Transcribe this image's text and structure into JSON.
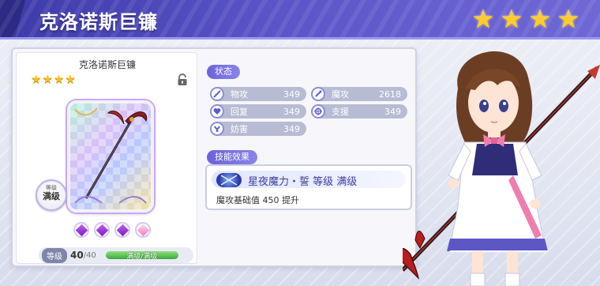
{
  "header": {
    "title": "克洛诺斯巨镰",
    "stars": [
      "★",
      "★",
      "★",
      "★"
    ]
  },
  "weapon": {
    "name": "克洛诺斯巨镰",
    "stars": [
      "★",
      "★",
      "★",
      "★"
    ],
    "badge_small": "等级",
    "badge_main": "满级",
    "gems": [
      "purple",
      "purple",
      "purple",
      "pink"
    ],
    "level_label": "等级",
    "level_current": "40",
    "level_max": "/40",
    "level_progress": 1.0,
    "level_bar_text": "满级/满级"
  },
  "status": {
    "tab": "状态",
    "stats": [
      {
        "icon": "sword-icon",
        "label": "物攻",
        "value": "349"
      },
      {
        "icon": "magic-wand-icon",
        "label": "魔攻",
        "value": "2618"
      },
      {
        "icon": "heal-icon",
        "label": "回复",
        "value": "349"
      },
      {
        "icon": "support-icon",
        "label": "支援",
        "value": "349"
      },
      {
        "icon": "hinder-icon",
        "label": "妨害",
        "value": "349"
      }
    ]
  },
  "skill": {
    "tab": "技能效果",
    "title": "星夜魔力・誓  等级 满级",
    "desc": "魔攻基础值 450 提升"
  },
  "colors": {
    "header": "#4b47b8",
    "tab": "#6c62d9",
    "star": "#ffcc2e",
    "stat_pill": "#b7bcd4"
  }
}
